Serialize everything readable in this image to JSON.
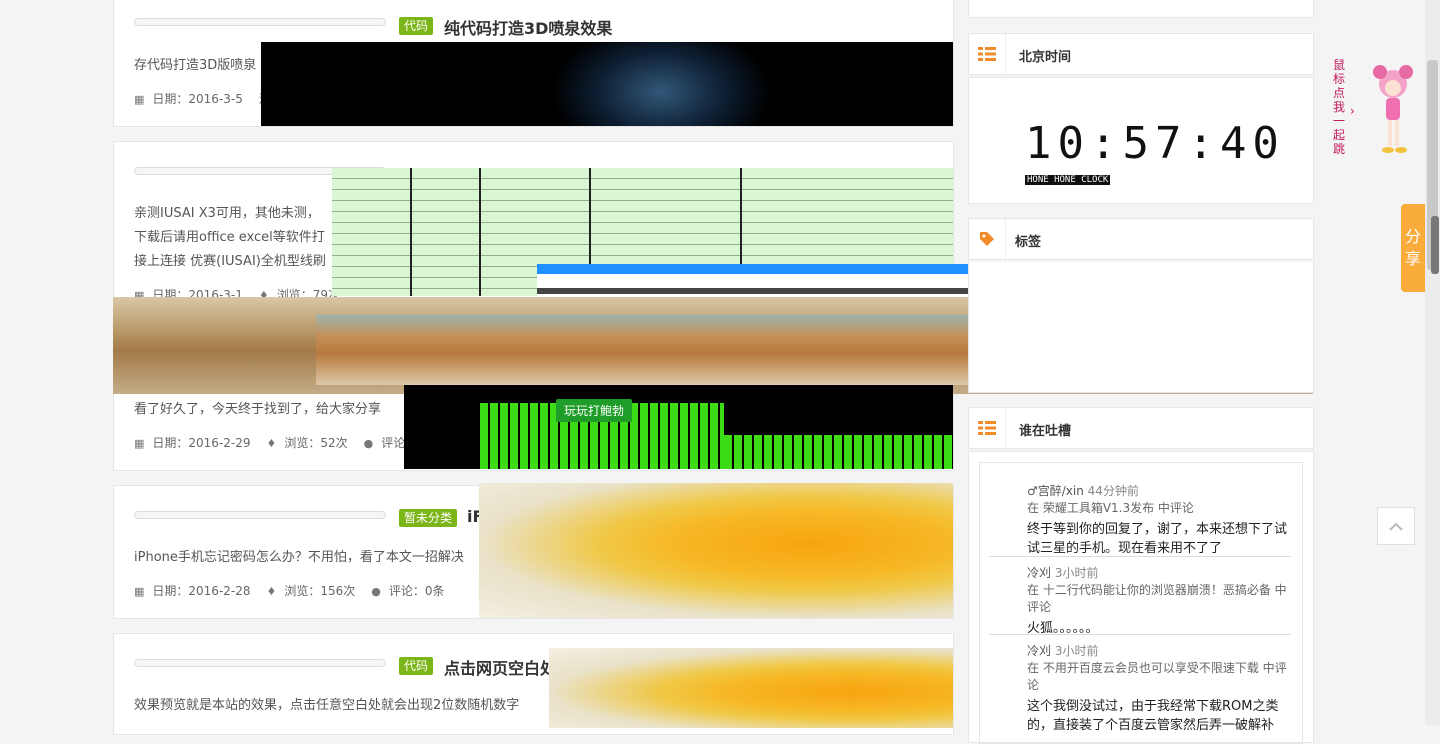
{
  "posts": [
    {
      "tag": "代码",
      "title": "纯代码打造3D喷泉效果",
      "summary": "存代码打造3D版喷泉",
      "date": "日期：2016-3-5",
      "views": "浏",
      "comments": ""
    },
    {
      "tag": "",
      "title": "",
      "summary_lines": [
        "亲测IUSAI X3可用，其他未测，",
        "下载后请用office excel等软件打",
        "接上连接 优赛(IUSAI)全机型线刷"
      ],
      "date": "日期：2016-3-1",
      "views": "浏览：79次",
      "comments": ""
    },
    {
      "tag": "",
      "title": "",
      "summary": "看了好久了，今天终于找到了，给大家分享",
      "date": "日期：2016-2-29",
      "views": "浏览：52次",
      "comments": "评论：0条"
    },
    {
      "tag": "暂未分类",
      "title": "iF",
      "summary": "iPhone手机忘记密码怎么办？不用怕，看了本文一招解决",
      "date": "日期：2016-2-28",
      "views": "浏览：156次",
      "comments": "评论：0条"
    },
    {
      "tag": "代码",
      "title": "点击网页空白处",
      "summary": "效果预览就是本站的效果，点击任意空白处就会出现2位数随机数字"
    }
  ],
  "overlay": {
    "tooltip": "玩玩打鲍勃"
  },
  "sidebar": {
    "time_widget": {
      "title": "北京时间",
      "clock": "10:57:40",
      "clock_brand": "HONE HONE CLOCK"
    },
    "tags_widget": {
      "title": "标签"
    },
    "comments_widget": {
      "title": "谁在吐槽",
      "items": [
        {
          "user": "♂宫醉/xin",
          "time": "44分钟前",
          "post": "在 荣耀工具箱V1.3发布 中评论",
          "text": "终于等到你的回复了，谢了，本来还想下了试试三星的手机。现在看来用不了了"
        },
        {
          "user": "冷刈",
          "time": "3小时前",
          "post": "在 十二行代码能让你的浏览器崩溃！恶搞必备 中评论",
          "text": "火狐。。。。。。"
        },
        {
          "user": "冷刈",
          "time": "3小时前",
          "post": "在 不用开百度云会员也可以享受不限速下载 中评论",
          "text": "这个我倒没试过，由于我经常下载ROM之类的，直接装了个百度云管家然后弄一破解补"
        }
      ]
    }
  },
  "float": {
    "mascot_text": "鼠标点我一起跳",
    "share": "分享",
    "back_top": "^"
  },
  "colors": {
    "tag_green": "#7cb518",
    "widget_orange": "#f28c28",
    "share_orange": "#f9ab3c"
  }
}
